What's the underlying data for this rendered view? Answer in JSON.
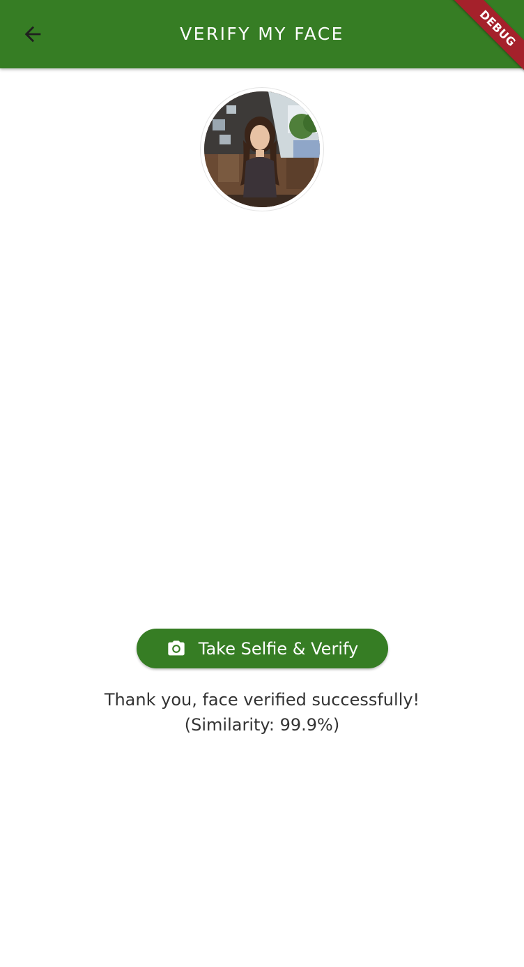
{
  "appbar": {
    "title": "VERIFY MY FACE",
    "back_icon": "arrow-back-icon",
    "background_color": "#367D24"
  },
  "debug_banner": {
    "label": "DEBUG",
    "color": "#A5212B"
  },
  "profile": {
    "avatar_alt": "profile photo"
  },
  "actions": {
    "selfie_button_label": "Take Selfie & Verify",
    "selfie_button_icon": "camera-icon"
  },
  "result": {
    "message": "Thank you, face verified successfully!",
    "similarity": "(Similarity: 99.9%)"
  }
}
